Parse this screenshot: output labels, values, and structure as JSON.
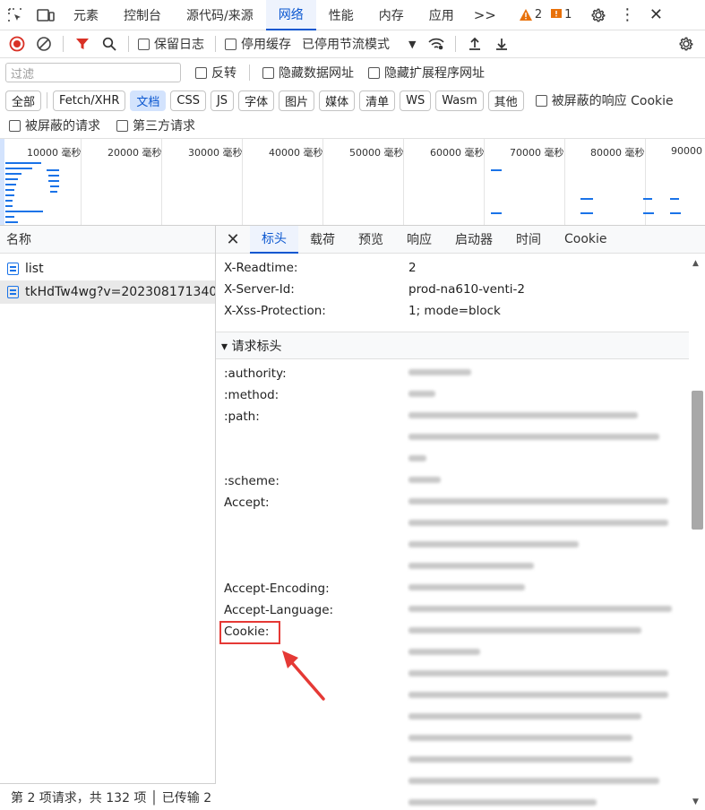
{
  "topbar": {
    "tabs": [
      {
        "label": "元素",
        "active": false
      },
      {
        "label": "控制台",
        "active": false
      },
      {
        "label": "源代码/来源",
        "active": false
      },
      {
        "label": "网络",
        "active": true
      },
      {
        "label": "性能",
        "active": false
      },
      {
        "label": "内存",
        "active": false
      },
      {
        "label": "应用",
        "active": false
      }
    ],
    "more": ">>",
    "warnings": "2",
    "issues": "1"
  },
  "toolbar": {
    "preserve_log": "保留日志",
    "disable_cache": "停用缓存",
    "throttle": "已停用节流模式"
  },
  "filter": {
    "placeholder": "过滤",
    "invert": "反转",
    "hide_data_urls": "隐藏数据网址",
    "hide_ext_urls": "隐藏扩展程序网址"
  },
  "chips": [
    "全部",
    "Fetch/XHR",
    "文档",
    "CSS",
    "JS",
    "字体",
    "图片",
    "媒体",
    "清单",
    "WS",
    "Wasm",
    "其他"
  ],
  "chips_selected": "文档",
  "blocked_cookies": "被屏蔽的响应 Cookie",
  "blocked_requests": "被屏蔽的请求",
  "third_party": "第三方请求",
  "timeline": {
    "labels": [
      "10000 毫秒",
      "20000 毫秒",
      "30000 毫秒",
      "40000 毫秒",
      "50000 毫秒",
      "60000 毫秒",
      "70000 毫秒",
      "80000 毫秒",
      "90000"
    ]
  },
  "list": {
    "header": "名称",
    "rows": [
      "list",
      "tkHdTw4wg?v=202308171340..."
    ]
  },
  "status": "第 2 项请求，共 132 项 │ 已传输 2",
  "details": {
    "tabs": [
      "标头",
      "载荷",
      "预览",
      "响应",
      "启动器",
      "时间",
      "Cookie"
    ],
    "response_headers": [
      {
        "name": "X-Readtime:",
        "value": "2"
      },
      {
        "name": "X-Server-Id:",
        "value": "prod-na610-venti-2"
      },
      {
        "name": "X-Xss-Protection:",
        "value": "1; mode=block"
      }
    ],
    "section_title": "▾ 请求标头",
    "request_headers": [
      ":authority:",
      ":method:",
      ":path:",
      ":scheme:",
      "Accept:",
      "Accept-Encoding:",
      "Accept-Language:",
      "Cookie:"
    ]
  }
}
